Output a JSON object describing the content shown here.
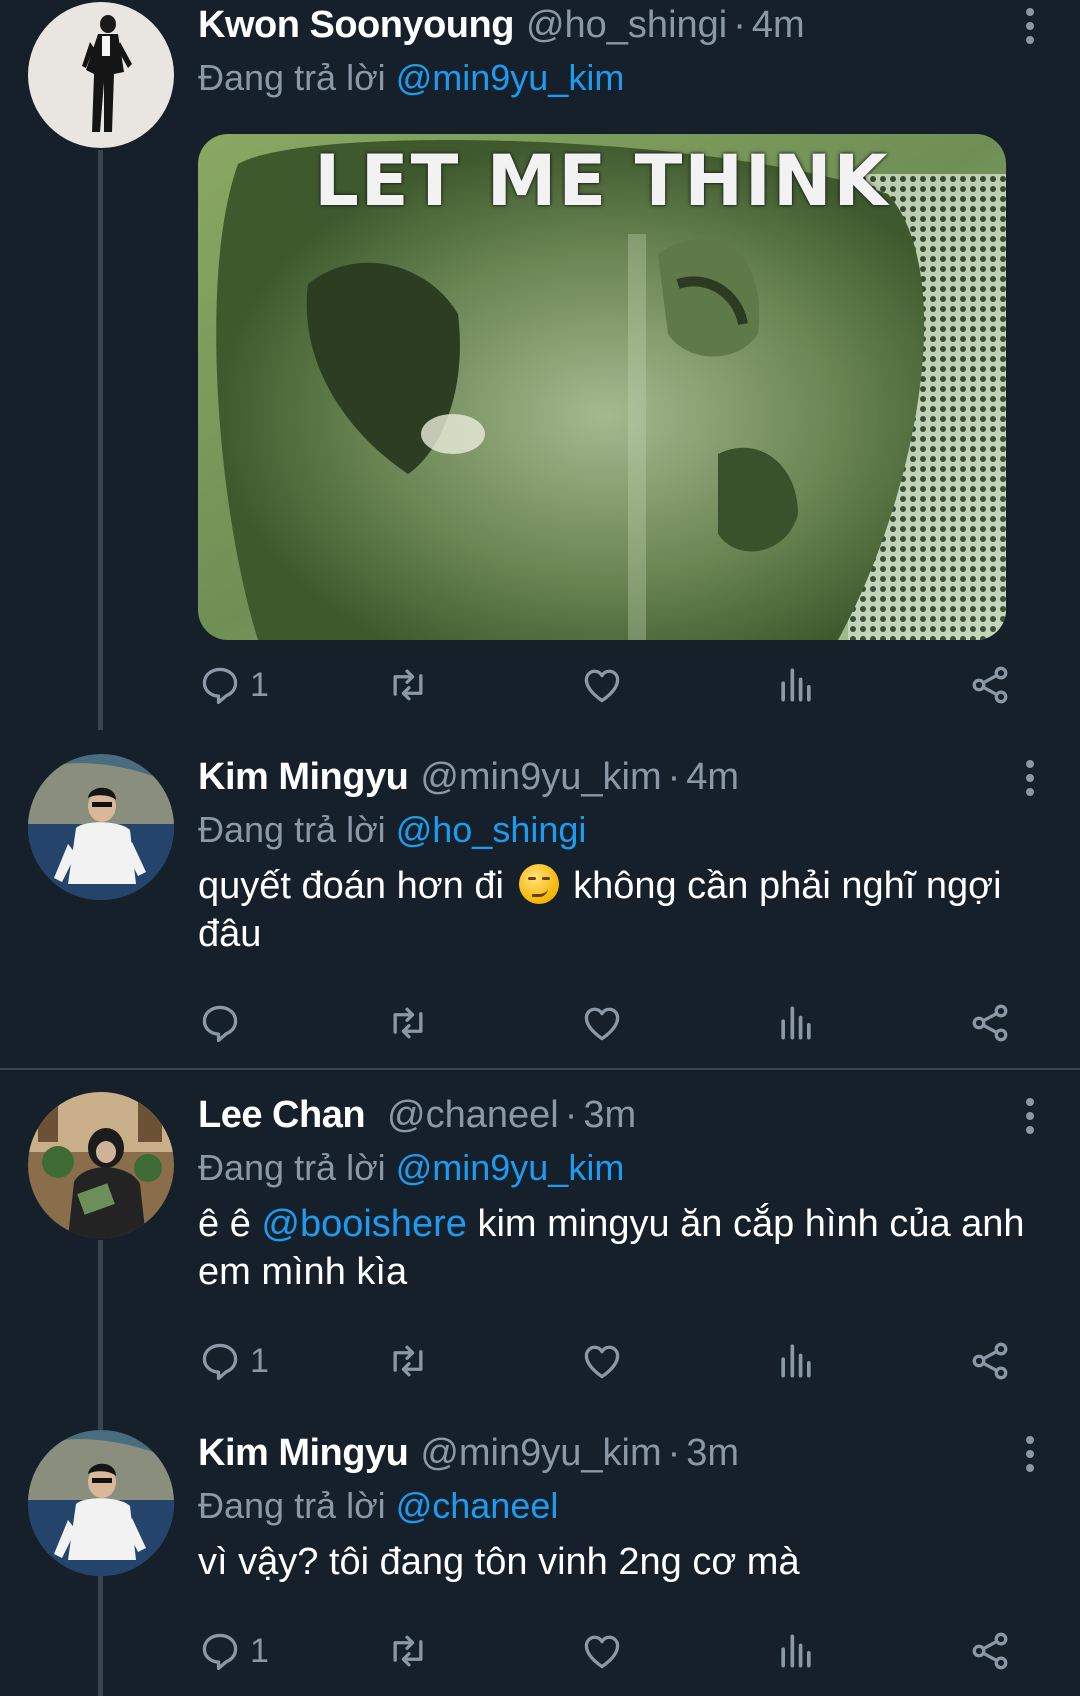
{
  "colors": {
    "background": "#15202b",
    "secondary_text": "#8b98a5",
    "mention": "#1d9bf0",
    "divider": "#38444d"
  },
  "tweets": [
    {
      "name": "Kwon Soonyoung",
      "handle": "@ho_shingi",
      "separator": "·",
      "time": "4m",
      "reply_prefix": "Đang trả lời",
      "reply_to": "@min9yu_kim",
      "media_caption": "LET ME THINK",
      "reply_count": "1"
    },
    {
      "name": "Kim Mingyu",
      "handle": "@min9yu_kim",
      "separator": "·",
      "time": "4m",
      "reply_prefix": "Đang trả lời",
      "reply_to": "@ho_shingi",
      "text_before_emoji": "quyết đoán hơn đi",
      "emoji": "smirking-face",
      "text_after_emoji": "không cần phải nghĩ ngợi đâu",
      "reply_count": ""
    },
    {
      "name": "Lee Chan",
      "handle": "@chaneel",
      "separator": "·",
      "time": "3m",
      "reply_prefix": "Đang trả lời",
      "reply_to": "@min9yu_kim",
      "text_prefix": "ê ê",
      "text_mention": "@booishere",
      "text_rest": "kim mingyu ăn cắp hình của anh em mình kìa",
      "reply_count": "1"
    },
    {
      "name": "Kim Mingyu",
      "handle": "@min9yu_kim",
      "separator": "·",
      "time": "3m",
      "reply_prefix": "Đang trả lời",
      "reply_to": "@chaneel",
      "text": "vì vậy? tôi đang tôn vinh 2ng cơ mà",
      "reply_count": "1"
    }
  ],
  "icons": [
    "reply-icon",
    "retweet-icon",
    "like-icon",
    "views-icon",
    "share-icon",
    "more-icon"
  ]
}
